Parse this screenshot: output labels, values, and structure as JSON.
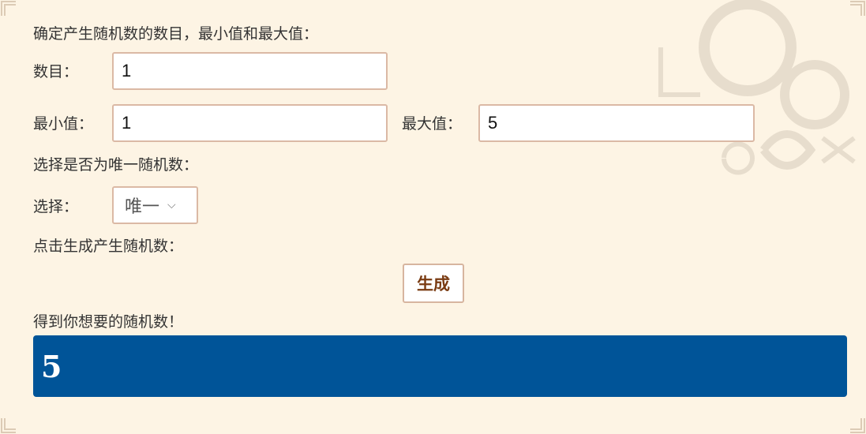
{
  "intro_text": "确定产生随机数的数目，最小值和最大值：",
  "count": {
    "label": "数目：",
    "value": "1"
  },
  "min": {
    "label": "最小值：",
    "value": "1"
  },
  "max": {
    "label": "最大值：",
    "value": "5"
  },
  "unique_prompt": "选择是否为唯一随机数：",
  "select": {
    "label": "选择：",
    "selected": "唯一",
    "icon": "chevron-down-icon"
  },
  "generate_prompt": "点击生成产生随机数：",
  "generate_button": "生成",
  "result_prompt": "得到你想要的随机数！",
  "result_value": "5",
  "colors": {
    "background": "#fdf4e4",
    "result_bg": "#005498",
    "button_text": "#7a3b12",
    "border": "#dbb9a5"
  }
}
